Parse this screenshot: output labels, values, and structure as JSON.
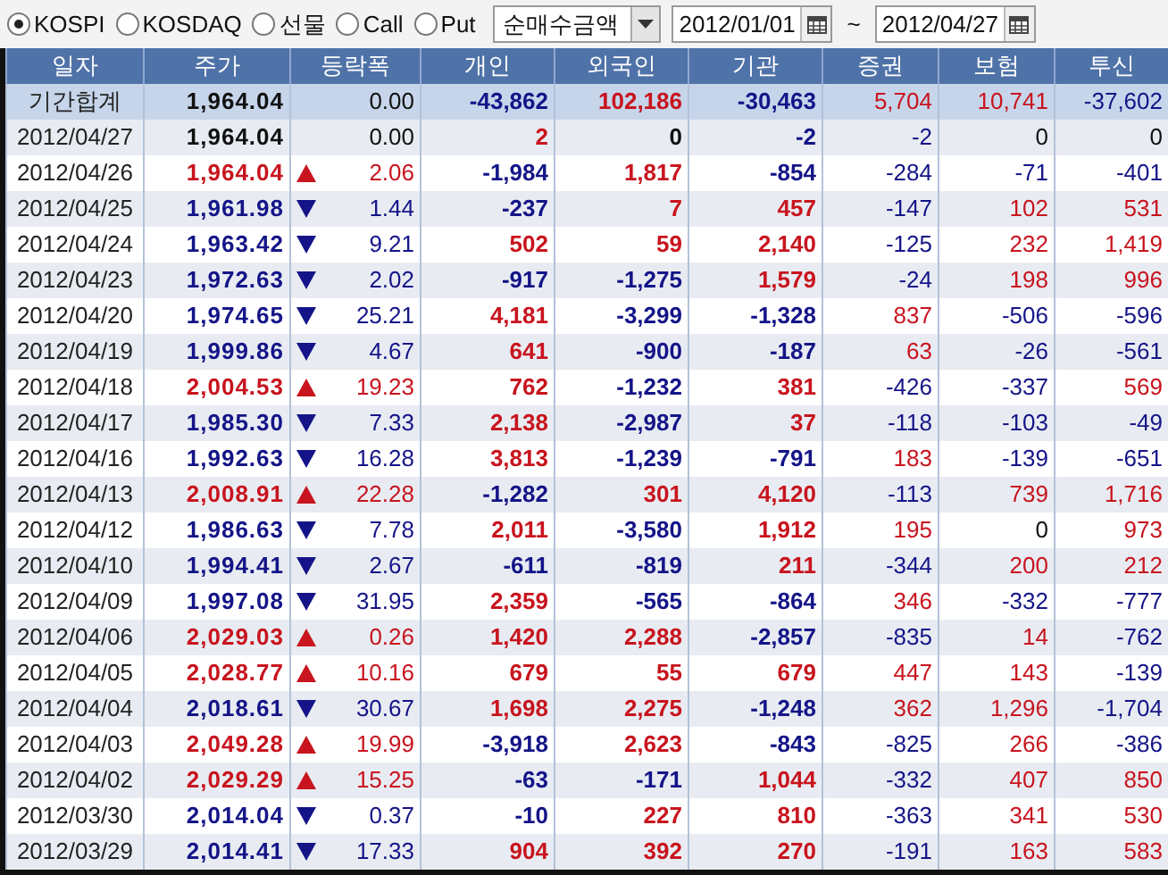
{
  "market_options": [
    {
      "label": "KOSPI",
      "selected": true
    },
    {
      "label": "KOSDAQ",
      "selected": false
    },
    {
      "label": "선물",
      "selected": false
    },
    {
      "label": "Call",
      "selected": false
    },
    {
      "label": "Put",
      "selected": false
    }
  ],
  "metric_dropdown": {
    "value": "순매수금액"
  },
  "date_from": {
    "value": "2012/01/01"
  },
  "range_separator": "~",
  "date_to": {
    "value": "2012/04/27"
  },
  "table": {
    "columns": [
      "일자",
      "주가",
      "등락폭",
      "개인",
      "외국인",
      "기관",
      "증권",
      "보험",
      "투신"
    ],
    "rows": [
      {
        "kind": "total",
        "date": "기간합계",
        "price": "1,964.04",
        "color": "#111111",
        "change": "0.00",
        "values": [
          {
            "text": "-43,862",
            "color": "#141488"
          },
          {
            "text": "102,186",
            "color": "#c8141e"
          },
          {
            "text": "-30,463",
            "color": "#141488"
          },
          {
            "text": "5,704",
            "color": "#c8141e"
          },
          {
            "text": "10,741",
            "color": "#c8141e"
          },
          {
            "text": "-37,602",
            "color": "#141488"
          }
        ]
      },
      {
        "kind": "day",
        "date": "2012/04/27",
        "price": "1,964.04",
        "color": "#111111",
        "change": "0.00",
        "values": [
          {
            "text": "2",
            "color": "#c8141e"
          },
          {
            "text": "0",
            "color": "#111111"
          },
          {
            "text": "-2",
            "color": "#141488"
          },
          {
            "text": "-2",
            "color": "#141488"
          },
          {
            "text": "0",
            "color": "#111111"
          },
          {
            "text": "0",
            "color": "#111111"
          }
        ]
      },
      {
        "kind": "day",
        "date": "2012/04/26",
        "price": "1,964.04",
        "color": "#c8141e",
        "arrow": {
          "kind": "up"
        },
        "change": "2.06",
        "values": [
          {
            "text": "-1,984",
            "color": "#141488"
          },
          {
            "text": "1,817",
            "color": "#c8141e"
          },
          {
            "text": "-854",
            "color": "#141488"
          },
          {
            "text": "-284",
            "color": "#141488"
          },
          {
            "text": "-71",
            "color": "#141488"
          },
          {
            "text": "-401",
            "color": "#141488"
          }
        ]
      },
      {
        "kind": "day",
        "date": "2012/04/25",
        "price": "1,961.98",
        "color": "#141488",
        "arrow": {
          "kind": "down"
        },
        "change": "1.44",
        "values": [
          {
            "text": "-237",
            "color": "#141488"
          },
          {
            "text": "7",
            "color": "#c8141e"
          },
          {
            "text": "457",
            "color": "#c8141e"
          },
          {
            "text": "-147",
            "color": "#141488"
          },
          {
            "text": "102",
            "color": "#c8141e"
          },
          {
            "text": "531",
            "color": "#c8141e"
          }
        ]
      },
      {
        "kind": "day",
        "date": "2012/04/24",
        "price": "1,963.42",
        "color": "#141488",
        "arrow": {
          "kind": "down"
        },
        "change": "9.21",
        "values": [
          {
            "text": "502",
            "color": "#c8141e"
          },
          {
            "text": "59",
            "color": "#c8141e"
          },
          {
            "text": "2,140",
            "color": "#c8141e"
          },
          {
            "text": "-125",
            "color": "#141488"
          },
          {
            "text": "232",
            "color": "#c8141e"
          },
          {
            "text": "1,419",
            "color": "#c8141e"
          }
        ]
      },
      {
        "kind": "day",
        "date": "2012/04/23",
        "price": "1,972.63",
        "color": "#141488",
        "arrow": {
          "kind": "down"
        },
        "change": "2.02",
        "values": [
          {
            "text": "-917",
            "color": "#141488"
          },
          {
            "text": "-1,275",
            "color": "#141488"
          },
          {
            "text": "1,579",
            "color": "#c8141e"
          },
          {
            "text": "-24",
            "color": "#141488"
          },
          {
            "text": "198",
            "color": "#c8141e"
          },
          {
            "text": "996",
            "color": "#c8141e"
          }
        ]
      },
      {
        "kind": "day",
        "date": "2012/04/20",
        "price": "1,974.65",
        "color": "#141488",
        "arrow": {
          "kind": "down"
        },
        "change": "25.21",
        "values": [
          {
            "text": "4,181",
            "color": "#c8141e"
          },
          {
            "text": "-3,299",
            "color": "#141488"
          },
          {
            "text": "-1,328",
            "color": "#141488"
          },
          {
            "text": "837",
            "color": "#c8141e"
          },
          {
            "text": "-506",
            "color": "#141488"
          },
          {
            "text": "-596",
            "color": "#141488"
          }
        ]
      },
      {
        "kind": "day",
        "date": "2012/04/19",
        "price": "1,999.86",
        "color": "#141488",
        "arrow": {
          "kind": "down"
        },
        "change": "4.67",
        "values": [
          {
            "text": "641",
            "color": "#c8141e"
          },
          {
            "text": "-900",
            "color": "#141488"
          },
          {
            "text": "-187",
            "color": "#141488"
          },
          {
            "text": "63",
            "color": "#c8141e"
          },
          {
            "text": "-26",
            "color": "#141488"
          },
          {
            "text": "-561",
            "color": "#141488"
          }
        ]
      },
      {
        "kind": "day",
        "date": "2012/04/18",
        "price": "2,004.53",
        "color": "#c8141e",
        "arrow": {
          "kind": "up"
        },
        "change": "19.23",
        "values": [
          {
            "text": "762",
            "color": "#c8141e"
          },
          {
            "text": "-1,232",
            "color": "#141488"
          },
          {
            "text": "381",
            "color": "#c8141e"
          },
          {
            "text": "-426",
            "color": "#141488"
          },
          {
            "text": "-337",
            "color": "#141488"
          },
          {
            "text": "569",
            "color": "#c8141e"
          }
        ]
      },
      {
        "kind": "day",
        "date": "2012/04/17",
        "price": "1,985.30",
        "color": "#141488",
        "arrow": {
          "kind": "down"
        },
        "change": "7.33",
        "values": [
          {
            "text": "2,138",
            "color": "#c8141e"
          },
          {
            "text": "-2,987",
            "color": "#141488"
          },
          {
            "text": "37",
            "color": "#c8141e"
          },
          {
            "text": "-118",
            "color": "#141488"
          },
          {
            "text": "-103",
            "color": "#141488"
          },
          {
            "text": "-49",
            "color": "#141488"
          }
        ]
      },
      {
        "kind": "day",
        "date": "2012/04/16",
        "price": "1,992.63",
        "color": "#141488",
        "arrow": {
          "kind": "down"
        },
        "change": "16.28",
        "values": [
          {
            "text": "3,813",
            "color": "#c8141e"
          },
          {
            "text": "-1,239",
            "color": "#141488"
          },
          {
            "text": "-791",
            "color": "#141488"
          },
          {
            "text": "183",
            "color": "#c8141e"
          },
          {
            "text": "-139",
            "color": "#141488"
          },
          {
            "text": "-651",
            "color": "#141488"
          }
        ]
      },
      {
        "kind": "day",
        "date": "2012/04/13",
        "price": "2,008.91",
        "color": "#c8141e",
        "arrow": {
          "kind": "up"
        },
        "change": "22.28",
        "values": [
          {
            "text": "-1,282",
            "color": "#141488"
          },
          {
            "text": "301",
            "color": "#c8141e"
          },
          {
            "text": "4,120",
            "color": "#c8141e"
          },
          {
            "text": "-113",
            "color": "#141488"
          },
          {
            "text": "739",
            "color": "#c8141e"
          },
          {
            "text": "1,716",
            "color": "#c8141e"
          }
        ]
      },
      {
        "kind": "day",
        "date": "2012/04/12",
        "price": "1,986.63",
        "color": "#141488",
        "arrow": {
          "kind": "down"
        },
        "change": "7.78",
        "values": [
          {
            "text": "2,011",
            "color": "#c8141e"
          },
          {
            "text": "-3,580",
            "color": "#141488"
          },
          {
            "text": "1,912",
            "color": "#c8141e"
          },
          {
            "text": "195",
            "color": "#c8141e"
          },
          {
            "text": "0",
            "color": "#111111"
          },
          {
            "text": "973",
            "color": "#c8141e"
          }
        ]
      },
      {
        "kind": "day",
        "date": "2012/04/10",
        "price": "1,994.41",
        "color": "#141488",
        "arrow": {
          "kind": "down"
        },
        "change": "2.67",
        "values": [
          {
            "text": "-611",
            "color": "#141488"
          },
          {
            "text": "-819",
            "color": "#141488"
          },
          {
            "text": "211",
            "color": "#c8141e"
          },
          {
            "text": "-344",
            "color": "#141488"
          },
          {
            "text": "200",
            "color": "#c8141e"
          },
          {
            "text": "212",
            "color": "#c8141e"
          }
        ]
      },
      {
        "kind": "day",
        "date": "2012/04/09",
        "price": "1,997.08",
        "color": "#141488",
        "arrow": {
          "kind": "down"
        },
        "change": "31.95",
        "values": [
          {
            "text": "2,359",
            "color": "#c8141e"
          },
          {
            "text": "-565",
            "color": "#141488"
          },
          {
            "text": "-864",
            "color": "#141488"
          },
          {
            "text": "346",
            "color": "#c8141e"
          },
          {
            "text": "-332",
            "color": "#141488"
          },
          {
            "text": "-777",
            "color": "#141488"
          }
        ]
      },
      {
        "kind": "day",
        "date": "2012/04/06",
        "price": "2,029.03",
        "color": "#c8141e",
        "arrow": {
          "kind": "up"
        },
        "change": "0.26",
        "values": [
          {
            "text": "1,420",
            "color": "#c8141e"
          },
          {
            "text": "2,288",
            "color": "#c8141e"
          },
          {
            "text": "-2,857",
            "color": "#141488"
          },
          {
            "text": "-835",
            "color": "#141488"
          },
          {
            "text": "14",
            "color": "#c8141e"
          },
          {
            "text": "-762",
            "color": "#141488"
          }
        ]
      },
      {
        "kind": "day",
        "date": "2012/04/05",
        "price": "2,028.77",
        "color": "#c8141e",
        "arrow": {
          "kind": "up"
        },
        "change": "10.16",
        "values": [
          {
            "text": "679",
            "color": "#c8141e"
          },
          {
            "text": "55",
            "color": "#c8141e"
          },
          {
            "text": "679",
            "color": "#c8141e"
          },
          {
            "text": "447",
            "color": "#c8141e"
          },
          {
            "text": "143",
            "color": "#c8141e"
          },
          {
            "text": "-139",
            "color": "#141488"
          }
        ]
      },
      {
        "kind": "day",
        "date": "2012/04/04",
        "price": "2,018.61",
        "color": "#141488",
        "arrow": {
          "kind": "down"
        },
        "change": "30.67",
        "values": [
          {
            "text": "1,698",
            "color": "#c8141e"
          },
          {
            "text": "2,275",
            "color": "#c8141e"
          },
          {
            "text": "-1,248",
            "color": "#141488"
          },
          {
            "text": "362",
            "color": "#c8141e"
          },
          {
            "text": "1,296",
            "color": "#c8141e"
          },
          {
            "text": "-1,704",
            "color": "#141488"
          }
        ]
      },
      {
        "kind": "day",
        "date": "2012/04/03",
        "price": "2,049.28",
        "color": "#c8141e",
        "arrow": {
          "kind": "up"
        },
        "change": "19.99",
        "values": [
          {
            "text": "-3,918",
            "color": "#141488"
          },
          {
            "text": "2,623",
            "color": "#c8141e"
          },
          {
            "text": "-843",
            "color": "#141488"
          },
          {
            "text": "-825",
            "color": "#141488"
          },
          {
            "text": "266",
            "color": "#c8141e"
          },
          {
            "text": "-386",
            "color": "#141488"
          }
        ]
      },
      {
        "kind": "day",
        "date": "2012/04/02",
        "price": "2,029.29",
        "color": "#c8141e",
        "arrow": {
          "kind": "up"
        },
        "change": "15.25",
        "values": [
          {
            "text": "-63",
            "color": "#141488"
          },
          {
            "text": "-171",
            "color": "#141488"
          },
          {
            "text": "1,044",
            "color": "#c8141e"
          },
          {
            "text": "-332",
            "color": "#141488"
          },
          {
            "text": "407",
            "color": "#c8141e"
          },
          {
            "text": "850",
            "color": "#c8141e"
          }
        ]
      },
      {
        "kind": "day",
        "date": "2012/03/30",
        "price": "2,014.04",
        "color": "#141488",
        "arrow": {
          "kind": "down"
        },
        "change": "0.37",
        "values": [
          {
            "text": "-10",
            "color": "#141488"
          },
          {
            "text": "227",
            "color": "#c8141e"
          },
          {
            "text": "810",
            "color": "#c8141e"
          },
          {
            "text": "-363",
            "color": "#141488"
          },
          {
            "text": "341",
            "color": "#c8141e"
          },
          {
            "text": "530",
            "color": "#c8141e"
          }
        ]
      },
      {
        "kind": "day",
        "date": "2012/03/29",
        "price": "2,014.41",
        "color": "#141488",
        "arrow": {
          "kind": "down"
        },
        "change": "17.33",
        "values": [
          {
            "text": "904",
            "color": "#c8141e"
          },
          {
            "text": "392",
            "color": "#c8141e"
          },
          {
            "text": "270",
            "color": "#c8141e"
          },
          {
            "text": "-191",
            "color": "#141488"
          },
          {
            "text": "163",
            "color": "#c8141e"
          },
          {
            "text": "583",
            "color": "#c8141e"
          }
        ]
      }
    ]
  }
}
